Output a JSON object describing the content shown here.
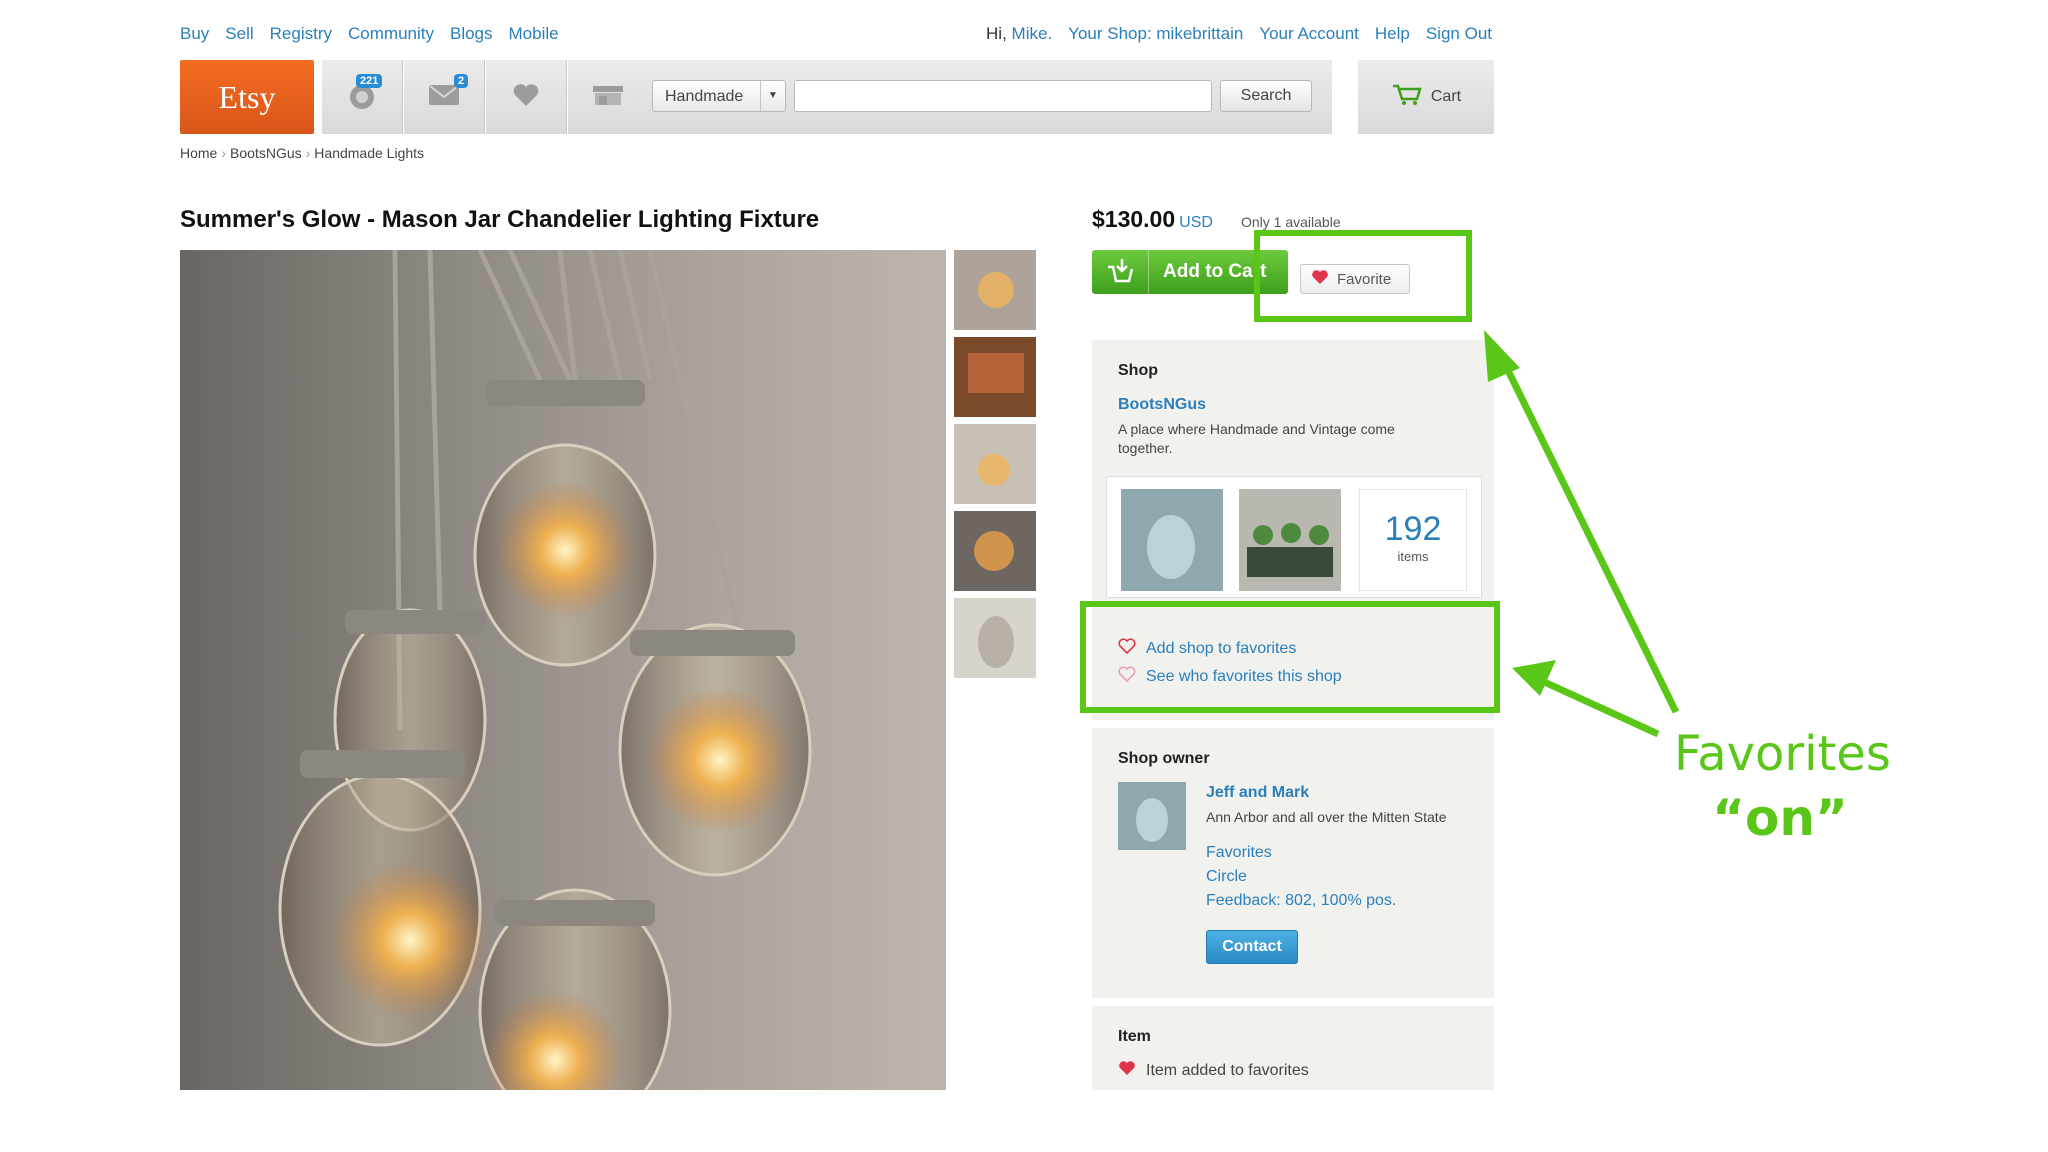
{
  "top_nav": {
    "links": [
      "Buy",
      "Sell",
      "Registry",
      "Community",
      "Blogs",
      "Mobile"
    ]
  },
  "user_nav": {
    "greeting_prefix": "Hi,",
    "user": "Mike.",
    "shop": "Your Shop: mikebrittain",
    "account": "Your Account",
    "help": "Help",
    "signout": "Sign Out"
  },
  "header": {
    "logo": "Etsy",
    "activity_badge": "221",
    "messages_badge": "2",
    "category": "Handmade",
    "search_value": "",
    "search_button": "Search",
    "cart": "Cart"
  },
  "breadcrumb": [
    "Home",
    "BootsNGus",
    "Handmade Lights"
  ],
  "listing": {
    "title": "Summer's Glow - Mason Jar Chandelier Lighting Fixture",
    "price": "$130.00",
    "currency": "USD",
    "availability": "Only 1 available",
    "add_to_cart": "Add to Cart",
    "favorite": "Favorite"
  },
  "shop_panel": {
    "heading": "Shop",
    "name": "BootsNGus",
    "description": "A place where Handmade and Vintage come together.",
    "item_count": "192",
    "item_label": "items",
    "add_favorites": "Add shop to favorites",
    "see_favorites": "See who favorites this shop"
  },
  "owner_panel": {
    "heading": "Shop owner",
    "name": "Jeff and Mark",
    "location": "Ann Arbor and all over the Mitten State",
    "favorites": "Favorites",
    "circle": "Circle",
    "feedback": "Feedback: 802, 100% pos.",
    "contact": "Contact"
  },
  "item_panel": {
    "heading": "Item",
    "status": "Item added to favorites"
  },
  "annotation": {
    "line1": "Favorites",
    "line2": "“on”",
    "color": "#5ac718"
  }
}
